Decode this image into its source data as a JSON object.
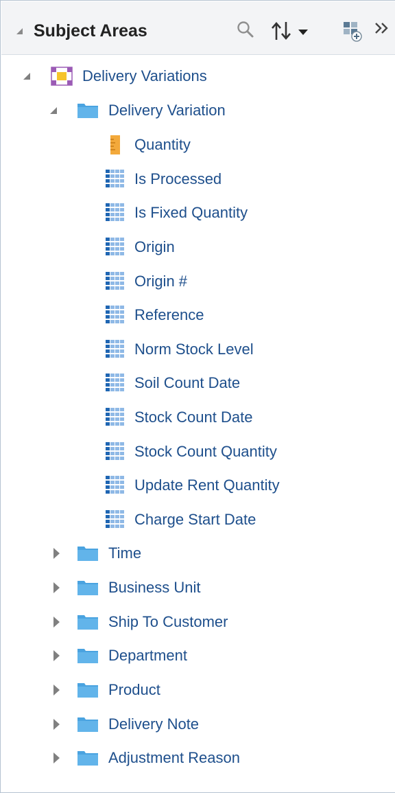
{
  "header": {
    "title": "Subject Areas",
    "icons": [
      "collapse-triangle-icon",
      "search-icon",
      "sort-icon",
      "add-subject-area-icon",
      "expand-panel-icon"
    ]
  },
  "colors": {
    "link": "#1e4f8c",
    "folder": "#4aa3e0",
    "measure": "#f3a93b",
    "subject_area": "#9b5bb5"
  },
  "tree": {
    "root": {
      "label": "Delivery Variations",
      "expanded": true,
      "folders": [
        {
          "label": "Delivery Variation",
          "expanded": true,
          "columns": [
            {
              "label": "Quantity",
              "kind": "measure"
            },
            {
              "label": "Is Processed",
              "kind": "attribute"
            },
            {
              "label": "Is Fixed Quantity",
              "kind": "attribute"
            },
            {
              "label": "Origin",
              "kind": "attribute"
            },
            {
              "label": "Origin #",
              "kind": "attribute"
            },
            {
              "label": "Reference",
              "kind": "attribute"
            },
            {
              "label": "Norm Stock Level",
              "kind": "attribute"
            },
            {
              "label": "Soil Count Date",
              "kind": "attribute"
            },
            {
              "label": "Stock Count Date",
              "kind": "attribute"
            },
            {
              "label": "Stock Count Quantity",
              "kind": "attribute"
            },
            {
              "label": "Update Rent Quantity",
              "kind": "attribute"
            },
            {
              "label": "Charge Start Date",
              "kind": "attribute"
            }
          ]
        },
        {
          "label": "Time",
          "expanded": false
        },
        {
          "label": "Business Unit",
          "expanded": false
        },
        {
          "label": "Ship To Customer",
          "expanded": false
        },
        {
          "label": "Department",
          "expanded": false
        },
        {
          "label": "Product",
          "expanded": false
        },
        {
          "label": "Delivery Note",
          "expanded": false
        },
        {
          "label": "Adjustment Reason",
          "expanded": false
        }
      ]
    }
  }
}
